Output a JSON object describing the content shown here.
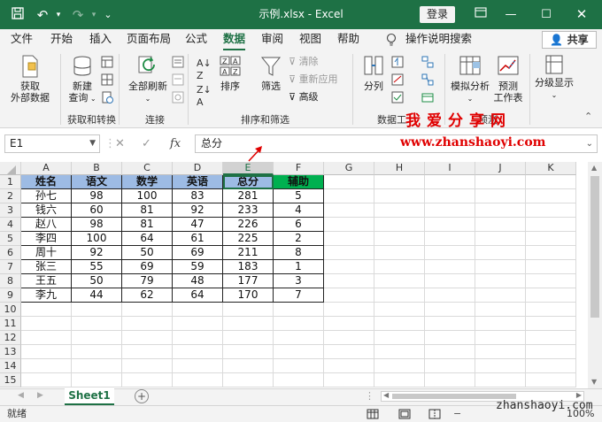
{
  "titlebar": {
    "title": "示例.xlsx - Excel",
    "login_label": "登录"
  },
  "menu": {
    "tabs": [
      "文件",
      "开始",
      "插入",
      "页面布局",
      "公式",
      "数据",
      "审阅",
      "视图",
      "帮助"
    ],
    "active_tab": "数据",
    "tell_me": "操作说明搜索",
    "share_label": "共享"
  },
  "ribbon": {
    "get_data": "获取\n外部数据",
    "new_query": "新建\n查询",
    "group_get_transform": "获取和转换",
    "refresh_all": "全部刷新",
    "group_connections": "连接",
    "sort": "排序",
    "filter": "筛选",
    "clear": "清除",
    "reapply": "重新应用",
    "advanced": "高级",
    "group_sort_filter": "排序和筛选",
    "text_to_columns": "分列",
    "group_data_tools": "数据工",
    "what_if": "模拟分析",
    "forecast_sheet": "预测\n工作表",
    "group_forecast": "预测",
    "outline": "分级显示"
  },
  "watermark": {
    "cn": "我爱分享网",
    "url": "www.zhanshaoyi.com",
    "url_bottom": "zhanshaoyi.com"
  },
  "formula_bar": {
    "name_box": "E1",
    "formula": "总分"
  },
  "grid": {
    "columns": [
      "A",
      "B",
      "C",
      "D",
      "E",
      "F",
      "G",
      "H",
      "I",
      "J",
      "K"
    ],
    "selected_column": "E",
    "row_numbers": [
      "1",
      "2",
      "3",
      "4",
      "5",
      "6",
      "7",
      "8",
      "9",
      "10",
      "11",
      "12",
      "13",
      "14",
      "15"
    ],
    "headers": [
      "姓名",
      "语文",
      "数学",
      "英语",
      "总分",
      "辅助"
    ],
    "rows": [
      [
        "孙七",
        "98",
        "100",
        "83",
        "281",
        "5"
      ],
      [
        "钱六",
        "60",
        "81",
        "92",
        "233",
        "4"
      ],
      [
        "赵八",
        "98",
        "81",
        "47",
        "226",
        "6"
      ],
      [
        "李四",
        "100",
        "64",
        "61",
        "225",
        "2"
      ],
      [
        "周十",
        "92",
        "50",
        "69",
        "211",
        "8"
      ],
      [
        "张三",
        "55",
        "69",
        "59",
        "183",
        "1"
      ],
      [
        "王五",
        "50",
        "79",
        "48",
        "177",
        "3"
      ],
      [
        "李九",
        "44",
        "62",
        "64",
        "170",
        "7"
      ]
    ]
  },
  "sheets": {
    "active": "Sheet1"
  },
  "status": {
    "mode": "就绪",
    "zoom": "100%"
  },
  "colors": {
    "excel_green": "#1e7145",
    "header_blue": "#9dbbe4",
    "helper_green": "#00b050",
    "watermark_red": "#e00000"
  }
}
